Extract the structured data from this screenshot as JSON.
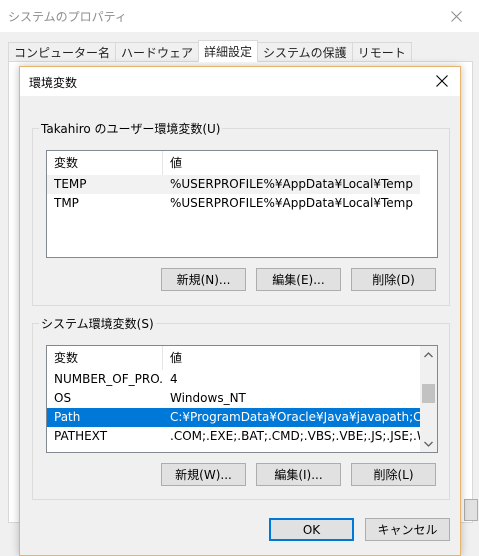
{
  "parent": {
    "title": "システムのプロパティ",
    "close_glyph": "✕",
    "tabs": [
      {
        "label": "コンピューター名",
        "active": false
      },
      {
        "label": "ハードウェア",
        "active": false
      },
      {
        "label": "詳細設定",
        "active": true
      },
      {
        "label": "システムの保護",
        "active": false
      },
      {
        "label": "リモート",
        "active": false
      }
    ]
  },
  "dialog": {
    "title": "環境変数",
    "close_glyph": "✕",
    "user_section": {
      "legend": "Takahiro のユーザー環境変数(U)",
      "columns": [
        "変数",
        "値"
      ],
      "rows": [
        {
          "name": "TEMP",
          "value": "%USERPROFILE%¥AppData¥Local¥Temp"
        },
        {
          "name": "TMP",
          "value": "%USERPROFILE%¥AppData¥Local¥Temp"
        }
      ],
      "buttons": {
        "new": "新規(N)...",
        "edit": "編集(E)...",
        "delete": "削除(D)"
      }
    },
    "system_section": {
      "legend": "システム環境変数(S)",
      "columns": [
        "変数",
        "値"
      ],
      "rows": [
        {
          "name": "NUMBER_OF_PRO...",
          "value": "4"
        },
        {
          "name": "OS",
          "value": "Windows_NT"
        },
        {
          "name": "Path",
          "value": "C:¥ProgramData¥Oracle¥Java¥javapath;C:¥Pr..."
        },
        {
          "name": "PATHEXT",
          "value": ".COM;.EXE;.BAT;.CMD;.VBS;.VBE;.JS;.JSE;.WSF..."
        }
      ],
      "selected_row": "Path",
      "buttons": {
        "new": "新規(W)...",
        "edit": "編集(I)...",
        "delete": "削除(L)"
      }
    },
    "footer": {
      "ok": "OK",
      "cancel": "キャンセル"
    }
  },
  "colors": {
    "selection": "#0078d7",
    "dialog_border": "#e8b36a"
  }
}
